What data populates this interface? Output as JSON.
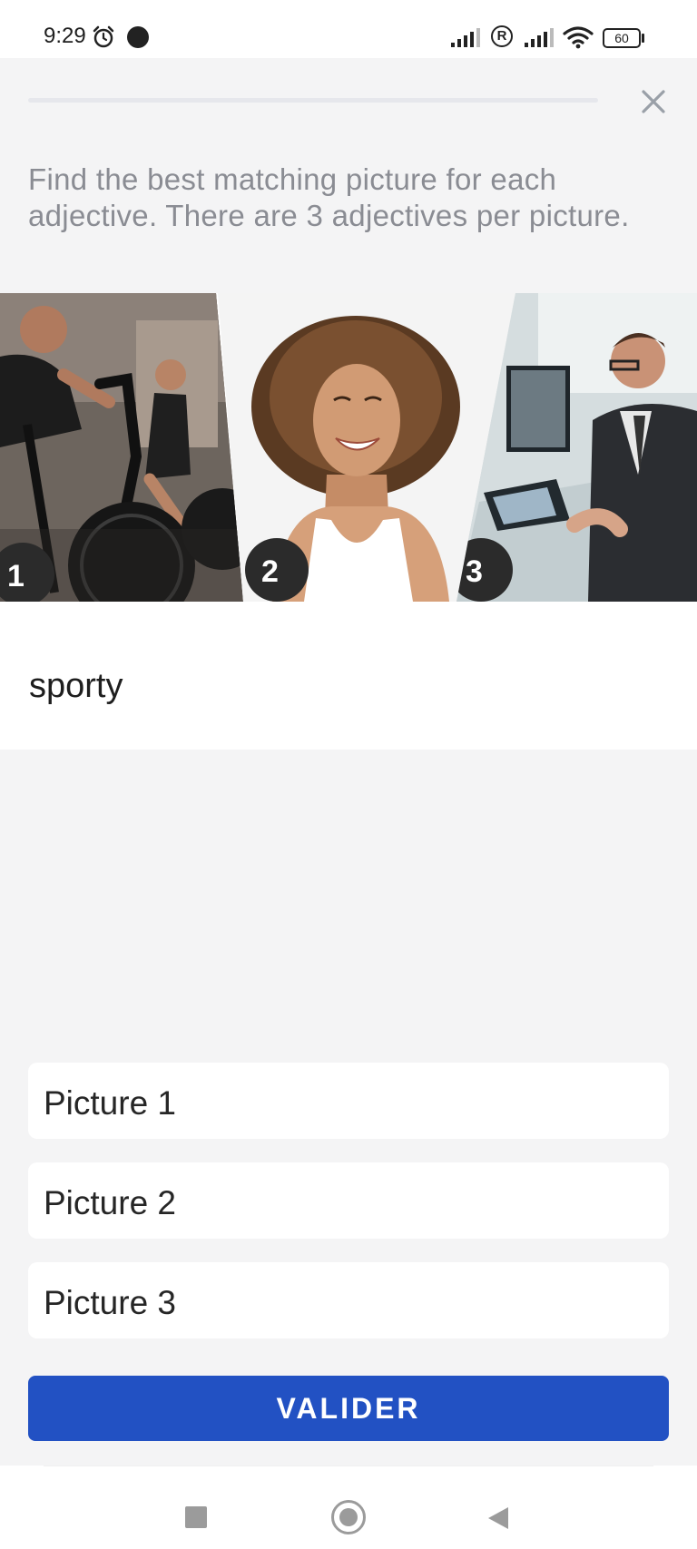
{
  "status_bar": {
    "time": "9:29",
    "battery_level": "60",
    "icons": [
      "alarm-icon",
      "dot-icon",
      "signal-icon",
      "registered-icon",
      "signal-icon",
      "wifi-icon",
      "battery-icon"
    ]
  },
  "header": {
    "progress": 0.0,
    "instructions": "Find the best matching picture for each adjective. There are 3 adjectives per picture.",
    "close_icon": "close-icon"
  },
  "pictures": [
    {
      "number": "1",
      "subject": "people exercising on air bikes in a gym"
    },
    {
      "number": "2",
      "subject": "smiling woman with curly hair"
    },
    {
      "number": "3",
      "subject": "businessman working at a computer"
    }
  ],
  "adjective": {
    "text": "sporty"
  },
  "options": [
    {
      "label": "Picture 1"
    },
    {
      "label": "Picture 2"
    },
    {
      "label": "Picture 3"
    }
  ],
  "validate_button": {
    "label": "VALIDER"
  },
  "colors": {
    "accent": "#2251c3",
    "background": "#f4f4f5",
    "card": "#ffffff",
    "instruction_text": "#8a8c93"
  },
  "nav_bar": {
    "icons": [
      "recent-apps-icon",
      "home-icon",
      "back-icon"
    ]
  }
}
